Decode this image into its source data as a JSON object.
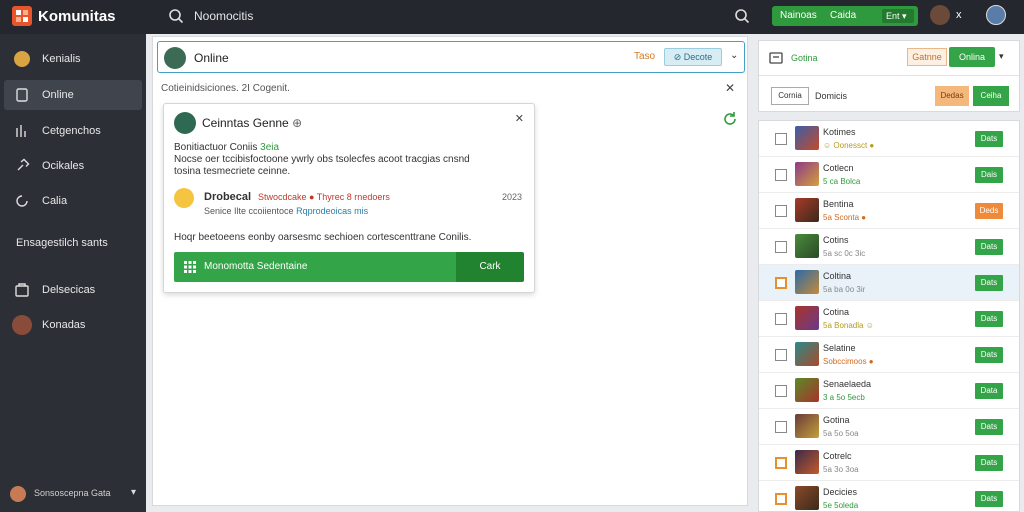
{
  "header": {
    "app_title": "Komunitas",
    "search_text": "Noomocitis",
    "green_label_1": "Nainoas",
    "green_label_2": "Caida",
    "green_select": "Ent",
    "close_text": "x"
  },
  "sidebar": {
    "items": [
      {
        "label": "Kenialis"
      },
      {
        "label": "Online"
      },
      {
        "label": "Cetgenchos"
      },
      {
        "label": "Ocikales"
      },
      {
        "label": "Calia"
      },
      {
        "label": "Ensagestilch sants"
      },
      {
        "label": "Delsecicas"
      },
      {
        "label": "Konadas"
      }
    ],
    "footer_label": "Sonsoscepna Gata"
  },
  "main": {
    "online_title": "Online",
    "online_tag": "Taso",
    "online_pill": "Decote",
    "subline": "Cotieinidsiciones. 2I Cogenit.",
    "card": {
      "title": "Ceinntas Genne",
      "title_badge": "⊕",
      "line1_prefix": "Bonitiactuor Coniis",
      "line1_green": "3eia",
      "line2": "Nocse oer tccibisfoctoone ywrly obs tsolecfes acoot tracgias cnsnd",
      "line3": "tosina tesmecriete ceinne.",
      "row_name": "Drobecal",
      "row_meta": "Stwocdcake ● Thyrec 8 rnedoers",
      "row_year": "2023",
      "row_sub_prefix": "Senice Ilte ccoiientoce",
      "row_sub_blue": "Rqprodeoicas mis",
      "desc": "Hoqr beetoeens eonby oarsesmc sechioen cortescenttrane Conilis.",
      "button_label": "Monomotta Sedentaine",
      "button_side": "Cark"
    }
  },
  "right_top": {
    "label": "Gotina",
    "btn_outline": "Gatnne",
    "btn_green": "Onlina",
    "btn_small": "Cornia",
    "label2": "Domicis",
    "btn_orange": "Dedas",
    "btn_green2": "Ceiha"
  },
  "games": [
    {
      "name": "Kotimes",
      "meta": "☺ Oonessct ●",
      "meta_color": "y",
      "btn": "Dats",
      "btn_orange": false,
      "cb_orange": false,
      "highlight": false
    },
    {
      "name": "Cotlecn",
      "meta": "5 ca Bolca",
      "meta_color": "g",
      "btn": "Dais",
      "btn_orange": false,
      "cb_orange": false,
      "highlight": false
    },
    {
      "name": "Bentina",
      "meta": "5a Sconta ●",
      "meta_color": "o",
      "btn": "Deds",
      "btn_orange": true,
      "cb_orange": false,
      "highlight": false
    },
    {
      "name": "Cotins",
      "meta": "5a sc 0c 3ic",
      "meta_color": "",
      "btn": "Dats",
      "btn_orange": false,
      "cb_orange": false,
      "highlight": false
    },
    {
      "name": "Coltina",
      "meta": "5a ba 0o 3ir",
      "meta_color": "",
      "btn": "Dats",
      "btn_orange": false,
      "cb_orange": true,
      "highlight": true
    },
    {
      "name": "Cotina",
      "meta": "5a Bonadla ☺",
      "meta_color": "y",
      "btn": "Dats",
      "btn_orange": false,
      "cb_orange": false,
      "highlight": false
    },
    {
      "name": "Selatine",
      "meta": "Sobccimoos ●",
      "meta_color": "o",
      "btn": "Dats",
      "btn_orange": false,
      "cb_orange": false,
      "highlight": false
    },
    {
      "name": "Senaelaeda",
      "meta": "3 a 5o 5ecb",
      "meta_color": "g",
      "btn": "Data",
      "btn_orange": false,
      "cb_orange": false,
      "highlight": false
    },
    {
      "name": "Gotina",
      "meta": "5a 5o 5oa",
      "meta_color": "",
      "btn": "Dats",
      "btn_orange": false,
      "cb_orange": false,
      "highlight": false
    },
    {
      "name": "Cotrelc",
      "meta": "5a 3o 3oa",
      "meta_color": "",
      "btn": "Dats",
      "btn_orange": false,
      "cb_orange": true,
      "highlight": false
    },
    {
      "name": "Decicies",
      "meta": "5e 5oleda",
      "meta_color": "g",
      "btn": "Dats",
      "btn_orange": false,
      "cb_orange": true,
      "highlight": false
    }
  ],
  "colors": {
    "topbar": "#24272e",
    "sidebar": "#2c2f36",
    "accent_green": "#33a447",
    "accent_orange": "#ee8a3a",
    "accent_blue": "#45a0c8"
  }
}
